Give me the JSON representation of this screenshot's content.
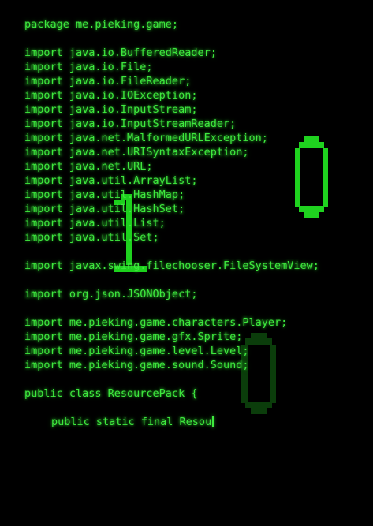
{
  "editor": {
    "lines": [
      {
        "text": "package me.pieking.game;"
      },
      {
        "text": ""
      },
      {
        "text": "import java.io.BufferedReader;"
      },
      {
        "text": "import java.io.File;"
      },
      {
        "text": "import java.io.FileReader;"
      },
      {
        "text": "import java.io.IOException;"
      },
      {
        "text": "import java.io.InputStream;"
      },
      {
        "text": "import java.io.InputStreamReader;"
      },
      {
        "text": "import java.net.MalformedURLException;"
      },
      {
        "text": "import java.net.URISyntaxException;"
      },
      {
        "text": "import java.net.URL;"
      },
      {
        "text": "import java.util.ArrayList;"
      },
      {
        "text": "import java.util.HashMap;"
      },
      {
        "text": "import java.util.HashSet;"
      },
      {
        "text": "import java.util.List;"
      },
      {
        "text": "import java.util.Set;"
      },
      {
        "text": ""
      },
      {
        "text": "import javax.swing.filechooser.FileSystemView;"
      },
      {
        "text": ""
      },
      {
        "text": "import org.json.JSONObject;"
      },
      {
        "text": ""
      },
      {
        "text": "import me.pieking.game.characters.Player;"
      },
      {
        "text": "import me.pieking.game.gfx.Sprite;"
      },
      {
        "text": "import me.pieking.game.level.Level;"
      },
      {
        "text": "import me.pieking.game.sound.Sound;"
      },
      {
        "text": ""
      },
      {
        "text": "public class ResourcePack {"
      },
      {
        "text": ""
      },
      {
        "text": "public static final Resou",
        "indent": true,
        "cursor": true
      }
    ]
  },
  "overlay_glyphs": [
    {
      "char": "1",
      "name": "digit-one-glyph"
    },
    {
      "char": "0",
      "name": "digit-zero-glyph-bright"
    },
    {
      "char": "0",
      "name": "digit-zero-glyph-dim"
    }
  ],
  "colors": {
    "background": "#000000",
    "text": "#3ee83e",
    "glyph_bright": "#1fd21f",
    "glyph_dim": "#0b3d0b"
  }
}
